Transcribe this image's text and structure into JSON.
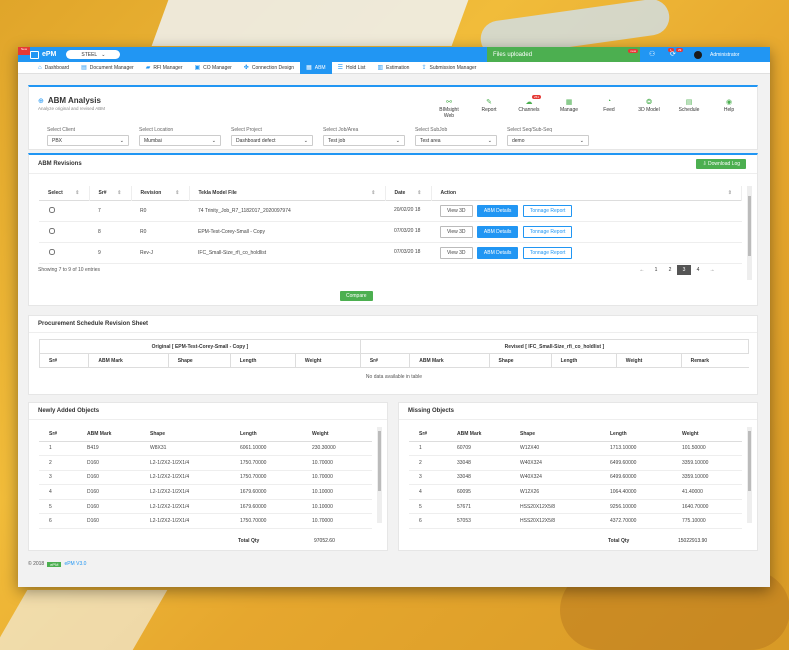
{
  "header": {
    "ribbon": "New",
    "logo": "ePM",
    "mode": "STEEL",
    "files_status": "Files uploaded",
    "files_badge": "new",
    "badge1": "1",
    "badge2": "29",
    "user": "Administrator"
  },
  "nav": [
    {
      "label": "Dashboard",
      "icon": "home-icon",
      "glyph": "⌂"
    },
    {
      "label": "Document Manager",
      "icon": "document-icon",
      "glyph": "▤"
    },
    {
      "label": "RFI Manager",
      "icon": "truck-icon",
      "glyph": "▰"
    },
    {
      "label": "CO Manager",
      "icon": "co-icon",
      "glyph": "▣"
    },
    {
      "label": "Connection Design",
      "icon": "puzzle-icon",
      "glyph": "✤"
    },
    {
      "label": "ABM",
      "icon": "abm-icon",
      "glyph": "▦",
      "active": true
    },
    {
      "label": "Hold List",
      "icon": "list-icon",
      "glyph": "☰"
    },
    {
      "label": "Estimation",
      "icon": "estimation-icon",
      "glyph": "▥"
    },
    {
      "label": "Submission Manager",
      "icon": "submission-icon",
      "glyph": "⇪"
    }
  ],
  "abm": {
    "title": "ABM Analysis",
    "subtitle": "Analyze original and revised ABM",
    "tools": [
      {
        "label": "BIMsight Web",
        "icon": "link-icon",
        "glyph": "⚯"
      },
      {
        "label": "Report",
        "icon": "pencil-icon",
        "glyph": "✎"
      },
      {
        "label": "Channels",
        "icon": "channels-icon",
        "glyph": "☁",
        "badge": "251"
      },
      {
        "label": "Manage",
        "icon": "grid-icon",
        "glyph": "▦"
      },
      {
        "label": "Feed",
        "icon": "rss-icon",
        "glyph": "◔"
      },
      {
        "label": "3D Model",
        "icon": "model-icon",
        "glyph": "❂"
      },
      {
        "label": "Schedule",
        "icon": "schedule-icon",
        "glyph": "▤"
      },
      {
        "label": "Help",
        "icon": "help-icon",
        "glyph": "◉"
      }
    ],
    "filters": [
      {
        "label": "Select Client",
        "value": "PBX"
      },
      {
        "label": "Select Location",
        "value": "Mumbai"
      },
      {
        "label": "Select Project",
        "value": "Dashboard defect"
      },
      {
        "label": "Select Job/Area",
        "value": "Test job"
      },
      {
        "label": "Select SubJob",
        "value": "Test area"
      },
      {
        "label": "Select Seq/Sub-Seq",
        "value": "demo"
      }
    ]
  },
  "revisions": {
    "title": "ABM Revisions",
    "download_label": "Download Log",
    "columns": [
      "Select",
      "Sr#",
      "Revision",
      "Tekla Model File",
      "Date",
      "Action"
    ],
    "rows": [
      {
        "sr": "7",
        "revision": "R0",
        "file": "74 Trinity_Job_R7_1182017_2020097974",
        "date": "20/02/20 18"
      },
      {
        "sr": "8",
        "revision": "R0",
        "file": "EPM-Test-Corey-Small - Copy",
        "date": "07/03/20 18"
      },
      {
        "sr": "9",
        "revision": "Rev-J",
        "file": "IFC_Small-Size_rfi_co_holdlist",
        "date": "07/03/20 18"
      }
    ],
    "actions": {
      "view3d": "View 3D",
      "details": "ABM Details",
      "tonnage": "Tonnage Report"
    },
    "showing": "Showing 7 to 9 of 10 entries",
    "pager": [
      "←",
      "1",
      "2",
      "3",
      "4",
      "→"
    ],
    "pager_current": "3",
    "compare_label": "Compare"
  },
  "procurement": {
    "title": "Procurement Schedule Revision Sheet",
    "original": "Original [ EPM-Test-Corey-Small - Copy ]",
    "revised": "Revised [ IFC_Small-Size_rfi_co_holdlist ]",
    "orig_columns": [
      "Sr#",
      "ABM Mark",
      "Shape",
      "Length",
      "Weight"
    ],
    "rev_columns": [
      "Sr#",
      "ABM Mark",
      "Shape",
      "Length",
      "Weight",
      "Remark"
    ],
    "empty": "No data available in table"
  },
  "newly_added": {
    "title": "Newly Added Objects",
    "columns": [
      "Sr#",
      "ABM Mark",
      "Shape",
      "Length",
      "Weight"
    ],
    "rows": [
      [
        "1",
        "B419",
        "W8X31",
        "6061.10000",
        "230.30000"
      ],
      [
        "2",
        "D160",
        "L2-1/2X2-1/2X1/4",
        "1750.70000",
        "10.70000"
      ],
      [
        "3",
        "D160",
        "L2-1/2X2-1/2X1/4",
        "1750.70000",
        "10.70000"
      ],
      [
        "4",
        "D160",
        "L2-1/2X2-1/2X1/4",
        "1679.60000",
        "10.10000"
      ],
      [
        "5",
        "D160",
        "L2-1/2X2-1/2X1/4",
        "1679.60000",
        "10.10000"
      ],
      [
        "6",
        "D160",
        "L2-1/2X2-1/2X1/4",
        "1750.70000",
        "10.70000"
      ]
    ],
    "total_label": "Total Qty",
    "total_value": "97052.60"
  },
  "missing": {
    "title": "Missing Objects",
    "columns": [
      "Sr#",
      "ABM Mark",
      "Shape",
      "Length",
      "Weight"
    ],
    "rows": [
      [
        "1",
        "60709",
        "W12X40",
        "1713.10000",
        "101.50000"
      ],
      [
        "2",
        "33048",
        "W40X324",
        "6499.60000",
        "3359.10000"
      ],
      [
        "3",
        "33048",
        "W40X324",
        "6499.60000",
        "3359.10000"
      ],
      [
        "4",
        "60095",
        "W12X26",
        "1064.40000",
        "41.40000"
      ],
      [
        "5",
        "57671",
        "HSS20X12X5/8",
        "9256.10000",
        "1640.70000"
      ],
      [
        "6",
        "57053",
        "HSS20X12X5/8",
        "4372.70000",
        "775.10000"
      ]
    ],
    "total_label": "Total Qty",
    "total_value": "15022913.90"
  },
  "footer": {
    "copyright": "© 2018",
    "brand_box": "ePM",
    "version": "ePM V3.0"
  }
}
